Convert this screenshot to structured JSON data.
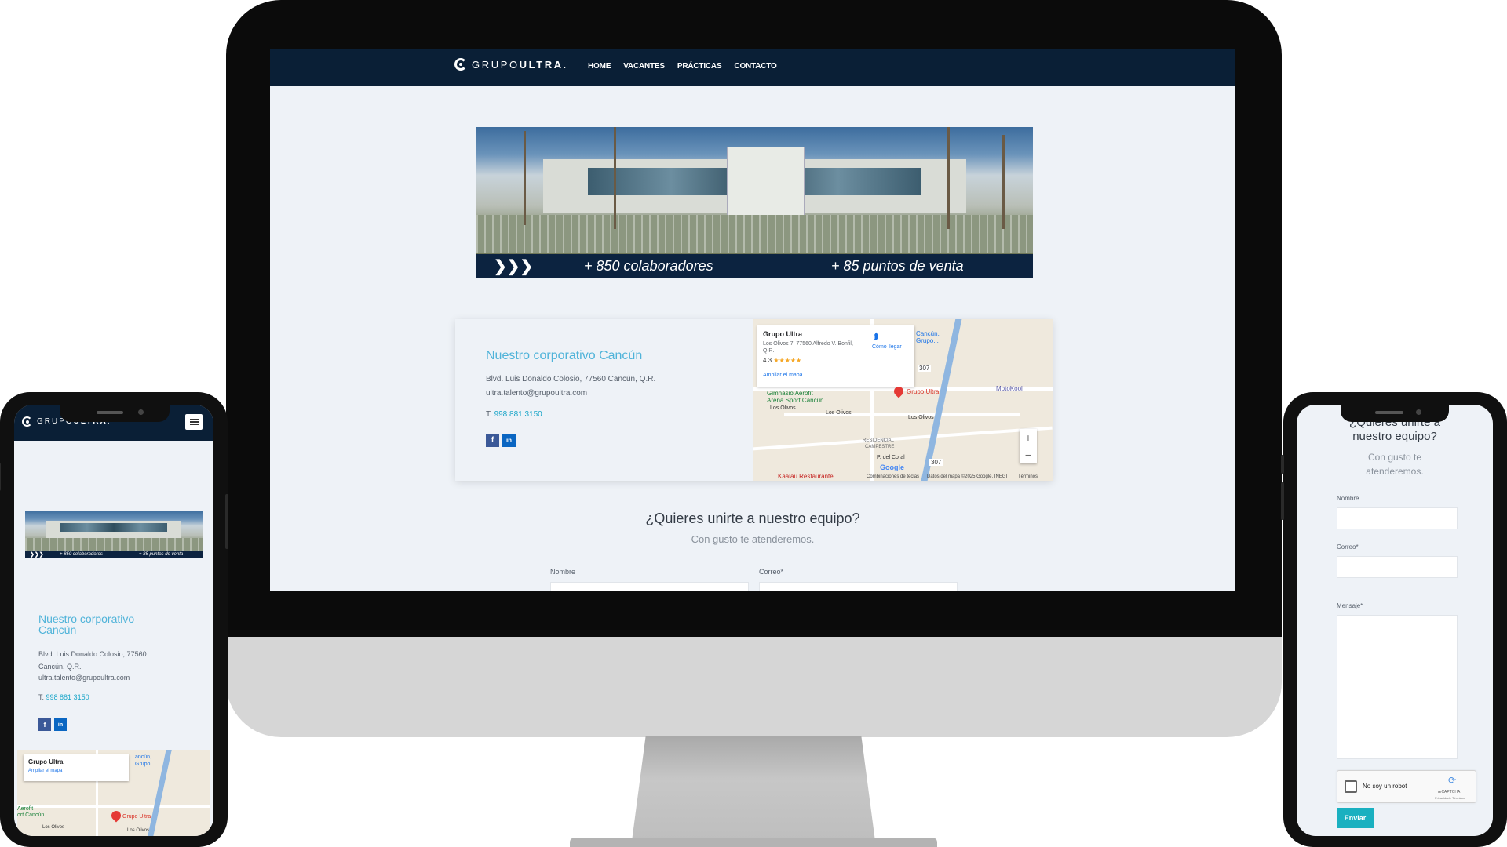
{
  "site": {
    "logo_prefix": "GRUPO",
    "logo_bold": "ULTRA",
    "logo_dot": "."
  },
  "nav": [
    {
      "label": "HOME"
    },
    {
      "label": "VACANTES"
    },
    {
      "label": "PRÁCTICAS"
    },
    {
      "label": "CONTACTO"
    }
  ],
  "hero": {
    "chevrons": "❯❯❯",
    "stat_left": "+ 850 colaboradores",
    "stat_right": "+ 85 puntos de venta"
  },
  "contact": {
    "title": "Nuestro corporativo Cancún",
    "title_mobile_line1": "Nuestro corporativo",
    "title_mobile_line2": "Cancún",
    "address": "Blvd. Luis Donaldo Colosio, 77560 Cancún, Q.R.",
    "address_mobile_line1": "Blvd. Luis Donaldo Colosio, 77560",
    "address_mobile_line2": "Cancún, Q.R.",
    "email": "ultra.talento@grupoultra.com",
    "phone_prefix": "T.",
    "phone": "998 881 3150",
    "facebook_glyph": "f",
    "linkedin_glyph": "in"
  },
  "map": {
    "place_name": "Grupo Ultra",
    "place_address_line1": "Los Olivos 7, 77560 Alfredo V. Bonfil,",
    "place_address_line2": "Q.R.",
    "rating": "4.3",
    "stars": "★★★★★",
    "directions": "Cómo llegar",
    "enlarge": "Ampliar el mapa",
    "pin_label": "Grupo Ultra",
    "label_cancun": "Cancún,",
    "label_grupo": "Grupo...",
    "label_arena": "Arena Sport Cancún",
    "label_aerofit": "Gimnasio Aerofit",
    "label_los_olivos_1": "Los Olivos",
    "label_los_olivos_2": "Los Olivos",
    "label_los_olivos_3": "Los Olivos",
    "label_residencial": "RESIDENCIAL",
    "label_campestre": "CAMPESTRE",
    "label_motokool": "MotoKool",
    "label_kaalau": "Kaalau Restaurante",
    "label_coral": "P. del Coral",
    "google": "Google",
    "shortcut": "Combinaciones de teclas",
    "data": "Datos del mapa ©2025 Google, INEGI",
    "terms": "Términos",
    "zoom_in": "+",
    "zoom_out": "−",
    "hw_sign": "307",
    "hw_sign_2": "307",
    "mobile_aerofit_line1": "Aerofit",
    "mobile_aerofit_line2": "ort Cancún",
    "mobile_cancun": "ancún,",
    "mobile_grupo": "Grupo..."
  },
  "join": {
    "title": "¿Quieres unirte a nuestro equipo?",
    "subtitle": "Con gusto te atenderemos.",
    "title_mobile_line1": "¿Quieres unirte a",
    "title_mobile_line2": "nuestro equipo?",
    "subtitle_mobile_line1": "Con gusto te",
    "subtitle_mobile_line2": "atenderemos."
  },
  "form": {
    "name_label": "Nombre",
    "email_label": "Correo",
    "message_label": "Mensaje",
    "required_mark": "*",
    "recaptcha_label": "No soy un robot",
    "recaptcha_brand": "reCAPTCHA",
    "recaptcha_links": "Privacidad - Términos",
    "submit": "Enviar"
  },
  "colors": {
    "header": "#0a1f36",
    "accent": "#4fb3d9",
    "link": "#18a5c8",
    "button": "#1ab0c0"
  }
}
